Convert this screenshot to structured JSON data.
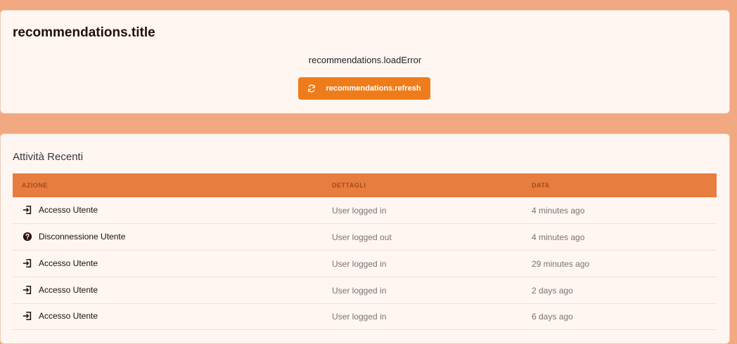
{
  "recommendations": {
    "title": "recommendations.title",
    "load_error": "recommendations.loadError",
    "refresh_label": "recommendations.refresh"
  },
  "activity": {
    "title": "Attività Recenti",
    "columns": [
      "AZIONE",
      "DETTAGLI",
      "DATA"
    ],
    "rows": [
      {
        "icon": "login-icon",
        "action": "Accesso Utente",
        "details": "User logged in",
        "date": "4 minutes ago"
      },
      {
        "icon": "question-circle-icon",
        "action": "Disconnessione Utente",
        "details": "User logged out",
        "date": "4 minutes ago"
      },
      {
        "icon": "login-icon",
        "action": "Accesso Utente",
        "details": "User logged in",
        "date": "29 minutes ago"
      },
      {
        "icon": "login-icon",
        "action": "Accesso Utente",
        "details": "User logged in",
        "date": "2 days ago"
      },
      {
        "icon": "login-icon",
        "action": "Accesso Utente",
        "details": "User logged in",
        "date": "6 days ago"
      }
    ]
  },
  "colors": {
    "background": "#f2a880",
    "accent": "#ef7c1b",
    "table_header": "#e87d40"
  }
}
